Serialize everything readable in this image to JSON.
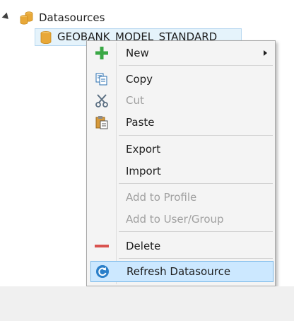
{
  "tree": {
    "root_label": "Datasources",
    "root_icon": "database-icon",
    "child_label": "GEOBANK_MODEL_STANDARD",
    "child_icon": "database-icon"
  },
  "context_menu": {
    "items": [
      {
        "label": "New",
        "icon": "plus-icon",
        "enabled": true,
        "submenu": true
      },
      {
        "label": "Copy",
        "icon": "copy-icon",
        "enabled": true
      },
      {
        "label": "Cut",
        "icon": "scissors-icon",
        "enabled": false
      },
      {
        "label": "Paste",
        "icon": "paste-icon",
        "enabled": true
      },
      {
        "label": "Export",
        "icon": "",
        "enabled": true
      },
      {
        "label": "Import",
        "icon": "",
        "enabled": true
      },
      {
        "label": "Add to Profile",
        "icon": "",
        "enabled": false
      },
      {
        "label": "Add to User/Group",
        "icon": "",
        "enabled": false
      },
      {
        "label": "Delete",
        "icon": "minus-icon",
        "enabled": true
      },
      {
        "label": "Refresh Datasource",
        "icon": "refresh-icon",
        "enabled": true,
        "highlighted": true
      }
    ]
  },
  "colors": {
    "plus": "#3aa845",
    "delete": "#d9534f",
    "refresh": "#2a7fc9",
    "database": "#e8a838",
    "highlight": "#cce8ff"
  }
}
